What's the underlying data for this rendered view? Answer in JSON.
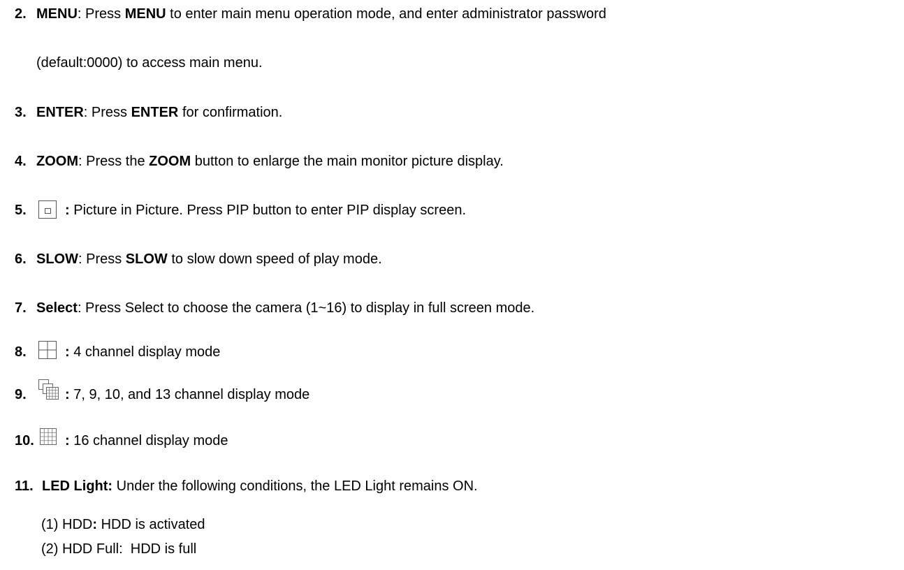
{
  "items": [
    {
      "number": "2.",
      "key": "MENU",
      "sep": ": Press ",
      "key2": "MENU",
      "text": " to enter main menu operation mode, and enter administrator password",
      "continuation": "(default:0000) to access main menu."
    },
    {
      "number": "3.",
      "key": "ENTER",
      "sep": ": Press ",
      "key2": "ENTER",
      "text": " for confirmation."
    },
    {
      "number": "4.",
      "key": "ZOOM",
      "sep": ": Press the ",
      "key2": "ZOOM",
      "text": " button to enlarge the main monitor picture display."
    },
    {
      "number": "5.",
      "icon": "pip-icon",
      "colon": ":",
      "text": " Picture in Picture. Press PIP button to enter PIP display screen."
    },
    {
      "number": "6.",
      "key": "SLOW",
      "sep": ": Press ",
      "key2": "SLOW",
      "text": " to slow down speed of play mode."
    },
    {
      "number": "7.",
      "key": "Select",
      "text": ": Press Select to choose the camera (1~16) to display in full screen mode."
    },
    {
      "number": "8.",
      "icon": "quad-grid-icon",
      "colon": ":",
      "text": " 4 channel display mode"
    },
    {
      "number": "9.",
      "icon": "multi-grid-icon",
      "colon": ":",
      "text": " 7, 9, 10, and 13 channel display mode"
    },
    {
      "number": "10.",
      "icon": "sixteen-grid-icon",
      "colon": ":",
      "text": " 16 channel display mode"
    },
    {
      "number": "11.",
      "key": "LED Light:",
      "text": " Under the following conditions, the LED Light remains ON.",
      "subitems": [
        {
          "prefix": "(1) HDD",
          "bold": ":",
          "text": " HDD is activated"
        },
        {
          "prefix": "(2) HDD Full:  HDD is full"
        }
      ]
    }
  ]
}
